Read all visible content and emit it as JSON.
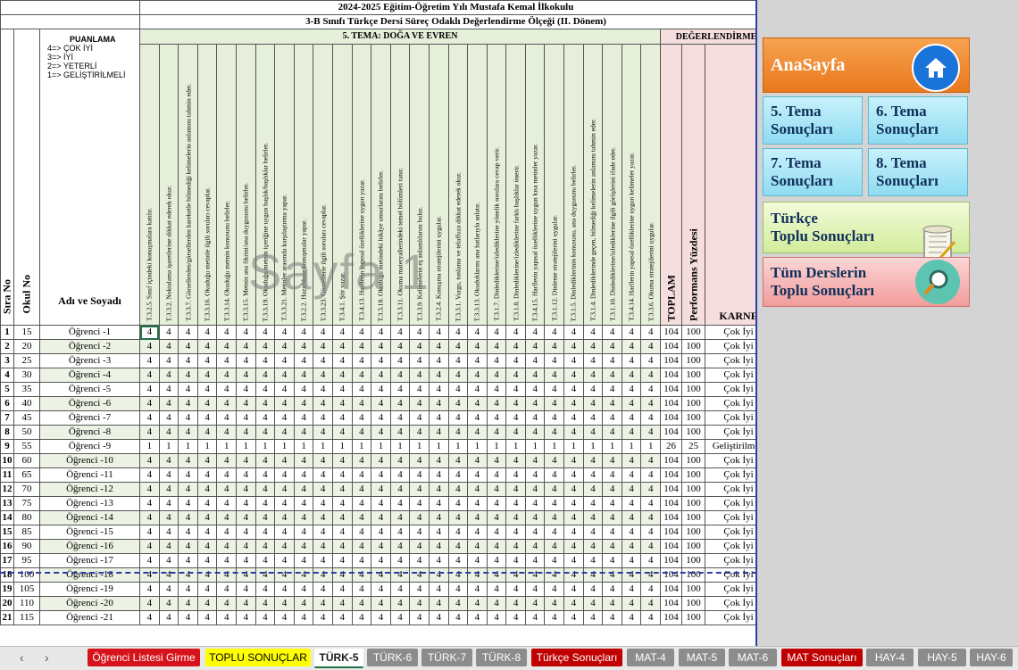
{
  "titles": {
    "line1": "2024-2025 Eğitim-Öğretim Yılı Mustafa Kemal İlkokulu",
    "line2": "3-B Sınıfı Türkçe Dersi Süreç Odaklı Değerlendirme Ölçeği (II. Dönem)"
  },
  "headers": {
    "sira_no": "Sıra No",
    "okul_no": "Okul No",
    "adi_soyadi": "Adı ve Soyadı",
    "tema": "5. TEMA: DOĞA VE EVREN",
    "degerlendirme": "DEĞERLENDİRME",
    "toplam": "TOPLAM",
    "performans": "Performans Yüzdesi",
    "karne": "KARNE"
  },
  "legend": {
    "title": "PUANLAMA",
    "items": [
      "4=> ÇOK İYİ",
      "3=> İYİ",
      "2=> YETERLİ",
      "1=> GELİŞTİRİLMELİ"
    ]
  },
  "watermark": "Sayfa 1",
  "criteria": [
    "T.3.2.5. Sınıf içindeki konuşmalara katılır.",
    "T.3.3.2. Noktalama işaretlerine dikkat ederek okur.",
    "T.3.3.7. Görsellerden/görsellerden hareketle bilmediği kelimelerin anlamını tahmin eder.",
    "T.3.3.16. Okuduğu metinle ilgili soruları cevaplar.",
    "T.3.3.14. Okuduğu metnin konusunu belirler.",
    "T.3.3.15. Metnin ana fikrini/ana duygusunu belirler.",
    "T.3.3.19. Okuduğu metnin içeriğine uygun başlık/başlıklar belirler.",
    "T.3.3.21. Metinler arasında karşılaştırma yapar.",
    "T.3.2.2. Hazırlıksız konuşmalar yapar.",
    "T.3.3.23. Görsellerle ilgili soruları cevaplar.",
    "T.3.4.1. Şiir yazar.",
    "T.3.4.13. Harflerin yapısal özelliklerine uygun yazar.",
    "T.3.3.18. Okuduğu metindeki hikâye unsurlarını belirler.",
    "T.3.3.11. Okuma materyallerindeki temel bölümleri tanır.",
    "T.3.3.9. Kelimelerin eş anlamlılarını bulur.",
    "T.3.2.4. Konuşma stratejilerini uygular.",
    "T.3.3.1. Vurgu, tonlama ve telaffuza dikkat ederek okur.",
    "T.3.3.13. Okuduklarını ana hatlarıyla anlatır.",
    "T.3.1.7. Dinlediklerine/izlediklerine yönelik sorulara cevap verir.",
    "T.3.1.8. Dinlediklerine/izlediklerine farklı başlıklar önerir.",
    "T.3.4.15. Harflerin yapısal özelliklerine uygun kısa metinler yazar.",
    "T.3.1.12. Dinleme stratejilerini uygular.",
    "T.3.1.5. Dinlediklerinin konusunu, ana duygusunu belirler.",
    "T.3.1.4. Dinlediklerinde geçen, bilmediği kelimelerin anlamını tahmin eder.",
    "T.3.1.10. Dinlediklerine/izlediklerine ilgili görüşlerini ifade eder.",
    "T.3.4.14. Harflerin yapısal özelliklerine uygun kelimeler yazar.",
    "T.3.3.6. Okuma stratejilerini uygular."
  ],
  "students": [
    {
      "no": "1",
      "okul": "15",
      "ad": "Öğrenci -1",
      "scores": [
        "4",
        "4",
        "4",
        "4",
        "4",
        "4",
        "4",
        "4",
        "4",
        "4",
        "4",
        "4",
        "4",
        "4",
        "4",
        "4",
        "4",
        "4",
        "4",
        "4",
        "4",
        "4",
        "4",
        "4",
        "4",
        "4",
        "4"
      ],
      "toplam": "104",
      "perf": "100",
      "karne": "Çok İyi"
    },
    {
      "no": "2",
      "okul": "20",
      "ad": "Öğrenci -2",
      "scores": [
        "4",
        "4",
        "4",
        "4",
        "4",
        "4",
        "4",
        "4",
        "4",
        "4",
        "4",
        "4",
        "4",
        "4",
        "4",
        "4",
        "4",
        "4",
        "4",
        "4",
        "4",
        "4",
        "4",
        "4",
        "4",
        "4",
        "4"
      ],
      "toplam": "104",
      "perf": "100",
      "karne": "Çok İyi"
    },
    {
      "no": "3",
      "okul": "25",
      "ad": "Öğrenci -3",
      "scores": [
        "4",
        "4",
        "4",
        "4",
        "4",
        "4",
        "4",
        "4",
        "4",
        "4",
        "4",
        "4",
        "4",
        "4",
        "4",
        "4",
        "4",
        "4",
        "4",
        "4",
        "4",
        "4",
        "4",
        "4",
        "4",
        "4",
        "4"
      ],
      "toplam": "104",
      "perf": "100",
      "karne": "Çok İyi"
    },
    {
      "no": "4",
      "okul": "30",
      "ad": "Öğrenci -4",
      "scores": [
        "4",
        "4",
        "4",
        "4",
        "4",
        "4",
        "4",
        "4",
        "4",
        "4",
        "4",
        "4",
        "4",
        "4",
        "4",
        "4",
        "4",
        "4",
        "4",
        "4",
        "4",
        "4",
        "4",
        "4",
        "4",
        "4",
        "4"
      ],
      "toplam": "104",
      "perf": "100",
      "karne": "Çok İyi"
    },
    {
      "no": "5",
      "okul": "35",
      "ad": "Öğrenci -5",
      "scores": [
        "4",
        "4",
        "4",
        "4",
        "4",
        "4",
        "4",
        "4",
        "4",
        "4",
        "4",
        "4",
        "4",
        "4",
        "4",
        "4",
        "4",
        "4",
        "4",
        "4",
        "4",
        "4",
        "4",
        "4",
        "4",
        "4",
        "4"
      ],
      "toplam": "104",
      "perf": "100",
      "karne": "Çok İyi"
    },
    {
      "no": "6",
      "okul": "40",
      "ad": "Öğrenci -6",
      "scores": [
        "4",
        "4",
        "4",
        "4",
        "4",
        "4",
        "4",
        "4",
        "4",
        "4",
        "4",
        "4",
        "4",
        "4",
        "4",
        "4",
        "4",
        "4",
        "4",
        "4",
        "4",
        "4",
        "4",
        "4",
        "4",
        "4",
        "4"
      ],
      "toplam": "104",
      "perf": "100",
      "karne": "Çok İyi"
    },
    {
      "no": "7",
      "okul": "45",
      "ad": "Öğrenci -7",
      "scores": [
        "4",
        "4",
        "4",
        "4",
        "4",
        "4",
        "4",
        "4",
        "4",
        "4",
        "4",
        "4",
        "4",
        "4",
        "4",
        "4",
        "4",
        "4",
        "4",
        "4",
        "4",
        "4",
        "4",
        "4",
        "4",
        "4",
        "4"
      ],
      "toplam": "104",
      "perf": "100",
      "karne": "Çok İyi"
    },
    {
      "no": "8",
      "okul": "50",
      "ad": "Öğrenci -8",
      "scores": [
        "4",
        "4",
        "4",
        "4",
        "4",
        "4",
        "4",
        "4",
        "4",
        "4",
        "4",
        "4",
        "4",
        "4",
        "4",
        "4",
        "4",
        "4",
        "4",
        "4",
        "4",
        "4",
        "4",
        "4",
        "4",
        "4",
        "4"
      ],
      "toplam": "104",
      "perf": "100",
      "karne": "Çok İyi"
    },
    {
      "no": "9",
      "okul": "55",
      "ad": "Öğrenci -9",
      "scores": [
        "1",
        "1",
        "1",
        "1",
        "1",
        "1",
        "1",
        "1",
        "1",
        "1",
        "1",
        "1",
        "1",
        "1",
        "1",
        "1",
        "1",
        "1",
        "1",
        "1",
        "1",
        "1",
        "1",
        "1",
        "1",
        "1",
        "1"
      ],
      "toplam": "26",
      "perf": "25",
      "karne": "Geliştirilmeli"
    },
    {
      "no": "10",
      "okul": "60",
      "ad": "Öğrenci -10",
      "scores": [
        "4",
        "4",
        "4",
        "4",
        "4",
        "4",
        "4",
        "4",
        "4",
        "4",
        "4",
        "4",
        "4",
        "4",
        "4",
        "4",
        "4",
        "4",
        "4",
        "4",
        "4",
        "4",
        "4",
        "4",
        "4",
        "4",
        "4"
      ],
      "toplam": "104",
      "perf": "100",
      "karne": "Çok İyi"
    },
    {
      "no": "11",
      "okul": "65",
      "ad": "Öğrenci -11",
      "scores": [
        "4",
        "4",
        "4",
        "4",
        "4",
        "4",
        "4",
        "4",
        "4",
        "4",
        "4",
        "4",
        "4",
        "4",
        "4",
        "4",
        "4",
        "4",
        "4",
        "4",
        "4",
        "4",
        "4",
        "4",
        "4",
        "4",
        "4"
      ],
      "toplam": "104",
      "perf": "100",
      "karne": "Çok İyi"
    },
    {
      "no": "12",
      "okul": "70",
      "ad": "Öğrenci -12",
      "scores": [
        "4",
        "4",
        "4",
        "4",
        "4",
        "4",
        "4",
        "4",
        "4",
        "4",
        "4",
        "4",
        "4",
        "4",
        "4",
        "4",
        "4",
        "4",
        "4",
        "4",
        "4",
        "4",
        "4",
        "4",
        "4",
        "4",
        "4"
      ],
      "toplam": "104",
      "perf": "100",
      "karne": "Çok İyi"
    },
    {
      "no": "13",
      "okul": "75",
      "ad": "Öğrenci -13",
      "scores": [
        "4",
        "4",
        "4",
        "4",
        "4",
        "4",
        "4",
        "4",
        "4",
        "4",
        "4",
        "4",
        "4",
        "4",
        "4",
        "4",
        "4",
        "4",
        "4",
        "4",
        "4",
        "4",
        "4",
        "4",
        "4",
        "4",
        "4"
      ],
      "toplam": "104",
      "perf": "100",
      "karne": "Çok İyi"
    },
    {
      "no": "14",
      "okul": "80",
      "ad": "Öğrenci -14",
      "scores": [
        "4",
        "4",
        "4",
        "4",
        "4",
        "4",
        "4",
        "4",
        "4",
        "4",
        "4",
        "4",
        "4",
        "4",
        "4",
        "4",
        "4",
        "4",
        "4",
        "4",
        "4",
        "4",
        "4",
        "4",
        "4",
        "4",
        "4"
      ],
      "toplam": "104",
      "perf": "100",
      "karne": "Çok İyi"
    },
    {
      "no": "15",
      "okul": "85",
      "ad": "Öğrenci -15",
      "scores": [
        "4",
        "4",
        "4",
        "4",
        "4",
        "4",
        "4",
        "4",
        "4",
        "4",
        "4",
        "4",
        "4",
        "4",
        "4",
        "4",
        "4",
        "4",
        "4",
        "4",
        "4",
        "4",
        "4",
        "4",
        "4",
        "4",
        "4"
      ],
      "toplam": "104",
      "perf": "100",
      "karne": "Çok İyi"
    },
    {
      "no": "16",
      "okul": "90",
      "ad": "Öğrenci -16",
      "scores": [
        "4",
        "4",
        "4",
        "4",
        "4",
        "4",
        "4",
        "4",
        "4",
        "4",
        "4",
        "4",
        "4",
        "4",
        "4",
        "4",
        "4",
        "4",
        "4",
        "4",
        "4",
        "4",
        "4",
        "4",
        "4",
        "4",
        "4"
      ],
      "toplam": "104",
      "perf": "100",
      "karne": "Çok İyi"
    },
    {
      "no": "17",
      "okul": "95",
      "ad": "Öğrenci -17",
      "scores": [
        "4",
        "4",
        "4",
        "4",
        "4",
        "4",
        "4",
        "4",
        "4",
        "4",
        "4",
        "4",
        "4",
        "4",
        "4",
        "4",
        "4",
        "4",
        "4",
        "4",
        "4",
        "4",
        "4",
        "4",
        "4",
        "4",
        "4"
      ],
      "toplam": "104",
      "perf": "100",
      "karne": "Çok İyi"
    },
    {
      "no": "18",
      "okul": "100",
      "ad": "Öğrenci -18",
      "scores": [
        "4",
        "4",
        "4",
        "4",
        "4",
        "4",
        "4",
        "4",
        "4",
        "4",
        "4",
        "4",
        "4",
        "4",
        "4",
        "4",
        "4",
        "4",
        "4",
        "4",
        "4",
        "4",
        "4",
        "4",
        "4",
        "4",
        "4"
      ],
      "toplam": "104",
      "perf": "100",
      "karne": "Çok İyi"
    },
    {
      "no": "19",
      "okul": "105",
      "ad": "Öğrenci -19",
      "scores": [
        "4",
        "4",
        "4",
        "4",
        "4",
        "4",
        "4",
        "4",
        "4",
        "4",
        "4",
        "4",
        "4",
        "4",
        "4",
        "4",
        "4",
        "4",
        "4",
        "4",
        "4",
        "4",
        "4",
        "4",
        "4",
        "4",
        "4"
      ],
      "toplam": "104",
      "perf": "100",
      "karne": "Çok İyi"
    },
    {
      "no": "20",
      "okul": "110",
      "ad": "Öğrenci -20",
      "scores": [
        "4",
        "4",
        "4",
        "4",
        "4",
        "4",
        "4",
        "4",
        "4",
        "4",
        "4",
        "4",
        "4",
        "4",
        "4",
        "4",
        "4",
        "4",
        "4",
        "4",
        "4",
        "4",
        "4",
        "4",
        "4",
        "4",
        "4"
      ],
      "toplam": "104",
      "perf": "100",
      "karne": "Çok İyi"
    },
    {
      "no": "21",
      "okul": "115",
      "ad": "Öğrenci -21",
      "scores": [
        "4",
        "4",
        "4",
        "4",
        "4",
        "4",
        "4",
        "4",
        "4",
        "4",
        "4",
        "4",
        "4",
        "4",
        "4",
        "4",
        "4",
        "4",
        "4",
        "4",
        "4",
        "4",
        "4",
        "4",
        "4",
        "4",
        "4"
      ],
      "toplam": "104",
      "perf": "100",
      "karne": "Çok İyi"
    }
  ],
  "sidebar": {
    "home": "AnaSayfa",
    "tema5": "5. Tema\nSonuçları",
    "tema6": "6. Tema\nSonuçları",
    "tema7": "7. Tema\nSonuçları",
    "tema8": "8. Tema\nSonuçları",
    "turkce": "Türkçe\nToplu Sonuçları",
    "tum": "Tüm Derslerin\nToplu Sonuçları"
  },
  "tabs": [
    {
      "label": "Öğrenci Listesi Girme",
      "bg": "#d6131b",
      "fg": "#ffffff"
    },
    {
      "label": "TOPLU SONUÇLAR",
      "bg": "#ffff00",
      "fg": "#000000"
    },
    {
      "label": "TÜRK-5",
      "bg": "#ffffff",
      "fg": "#1a1a1a",
      "active": true
    },
    {
      "label": "TÜRK-6",
      "bg": "#8c8c8c",
      "fg": "#ffffff"
    },
    {
      "label": "TÜRK-7",
      "bg": "#8c8c8c",
      "fg": "#ffffff"
    },
    {
      "label": "TÜRK-8",
      "bg": "#8c8c8c",
      "fg": "#ffffff"
    },
    {
      "label": "Türkçe Sonuçları",
      "bg": "#c00000",
      "fg": "#ffffff"
    },
    {
      "label": "MAT-4",
      "bg": "#8c8c8c",
      "fg": "#ffffff"
    },
    {
      "label": "MAT-5",
      "bg": "#8c8c8c",
      "fg": "#ffffff"
    },
    {
      "label": "MAT-6",
      "bg": "#8c8c8c",
      "fg": "#ffffff"
    },
    {
      "label": "MAT Sonuçları",
      "bg": "#c00000",
      "fg": "#ffffff"
    },
    {
      "label": "HAY-4",
      "bg": "#8c8c8c",
      "fg": "#ffffff"
    },
    {
      "label": "HAY-5",
      "bg": "#8c8c8c",
      "fg": "#ffffff"
    },
    {
      "label": "HAY-6",
      "bg": "#8c8c8c",
      "fg": "#ffffff"
    }
  ],
  "nav": {
    "prev": "‹",
    "next": "›"
  },
  "icons": {
    "home": "home-icon",
    "scroll": "scroll-icon",
    "magnifier": "magnifier-icon"
  }
}
